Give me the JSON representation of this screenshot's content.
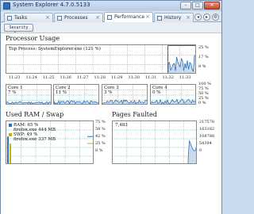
{
  "window": {
    "title": "System Explorer 4.7.0.5133"
  },
  "tabs": [
    {
      "label": "Tasks",
      "active": false
    },
    {
      "label": "Processes",
      "active": false
    },
    {
      "label": "Performance",
      "active": true
    },
    {
      "label": "History",
      "active": false
    }
  ],
  "toolbar": {
    "security_scan_label": "Security Scan"
  },
  "processor": {
    "heading": "Processor Usage",
    "top_process": "Top Process: SystemExplorer.exe (121 %)",
    "yticks": [
      "25 %",
      "17 %",
      "8 %"
    ],
    "times": [
      "11:23",
      "11:24",
      "11:25",
      "11:26",
      "11:27",
      "11:28",
      "11:29",
      "11:30",
      "11:31",
      "11:32",
      "11:33"
    ],
    "cores": [
      {
        "name": "Core 1",
        "value": "7 %"
      },
      {
        "name": "Core 2",
        "value": "11 %"
      },
      {
        "name": "Core 3",
        "value": "3 %"
      },
      {
        "name": "Core 4",
        "value": "0 %"
      }
    ],
    "core_yticks": [
      "100 %",
      "75 %",
      "50 %",
      "25 %",
      "0 %"
    ]
  },
  "ram": {
    "heading": "Used RAM / Swap",
    "ram_line": "RAM: 65 %",
    "ram_top": "firefox.exe 444 MB",
    "swap_line": "SWP: 49 %",
    "swap_top": "firefox.exe 337 MB",
    "yticks": [
      "75 %",
      "58 %",
      "42 %",
      "25 %",
      "8 %"
    ],
    "ram_color": "#2a6fb5",
    "swap_color": "#c8b400"
  },
  "pages": {
    "heading": "Pages Faulted",
    "value": "7,483",
    "yticks": [
      "217578",
      "163182",
      "108788",
      "54394",
      "0"
    ]
  },
  "colors": {
    "grid": "#2e8b8b",
    "line": "#1f5fa8",
    "fill": "#c8dcf0"
  }
}
